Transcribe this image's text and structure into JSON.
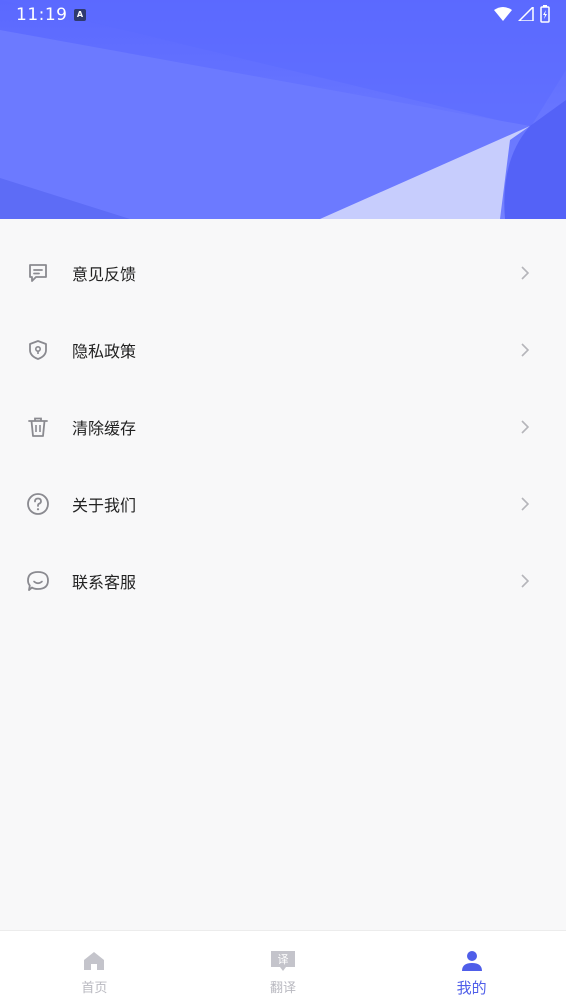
{
  "status_bar": {
    "time": "11:19",
    "notification_badge": "A"
  },
  "menu": {
    "items": [
      {
        "label": "意见反馈",
        "icon": "feedback-icon"
      },
      {
        "label": "隐私政策",
        "icon": "privacy-shield-icon"
      },
      {
        "label": "清除缓存",
        "icon": "trash-icon"
      },
      {
        "label": "关于我们",
        "icon": "help-circle-icon"
      },
      {
        "label": "联系客服",
        "icon": "chat-bubble-icon"
      }
    ]
  },
  "bottom_nav": {
    "items": [
      {
        "label": "首页",
        "icon": "home-icon",
        "active": false
      },
      {
        "label": "翻译",
        "icon": "translate-icon",
        "active": false,
        "icon_text": "译"
      },
      {
        "label": "我的",
        "icon": "user-icon",
        "active": true
      }
    ]
  },
  "colors": {
    "accent": "#4f5ee9",
    "header": "#5a68ff",
    "inactive": "#b9b9c0",
    "icon_gray": "#8a8a90"
  }
}
